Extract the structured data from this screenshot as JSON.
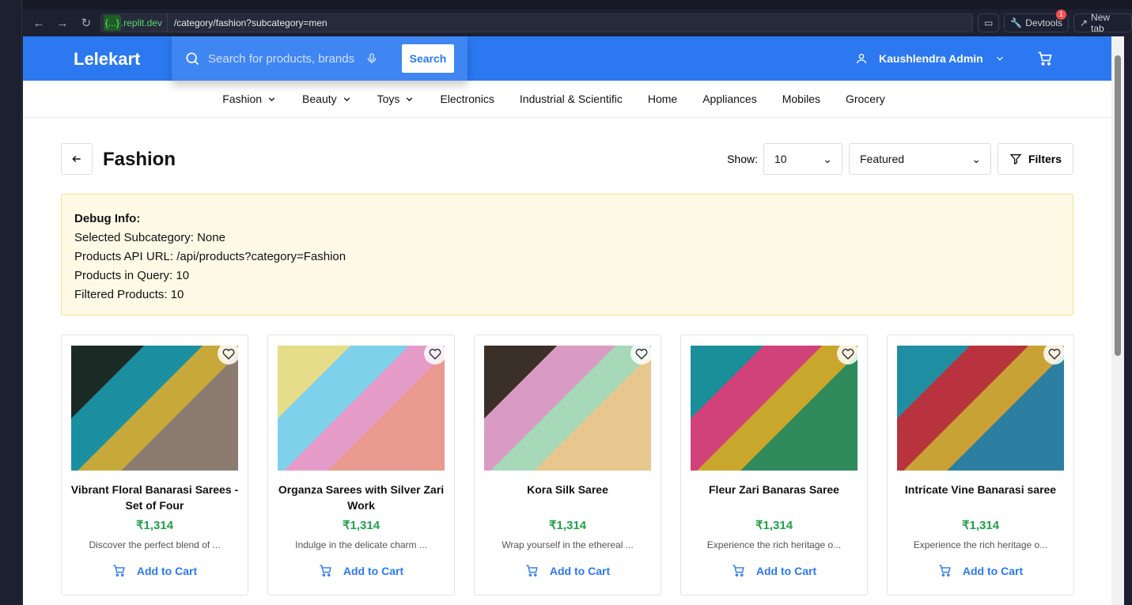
{
  "browser": {
    "domain_mask": "{...}",
    "domain": ".replit.dev",
    "path": "/category/fashion?subcategory=men",
    "devtools": "Devtools",
    "devtools_badge": "1",
    "new_tab": "New tab"
  },
  "header": {
    "logo": "Lelekart",
    "search_placeholder": "Search for products, brands and more",
    "search_button": "Search",
    "user": "Kaushlendra Admin"
  },
  "nav": [
    {
      "label": "Fashion",
      "dropdown": true
    },
    {
      "label": "Beauty",
      "dropdown": true
    },
    {
      "label": "Toys",
      "dropdown": true
    },
    {
      "label": "Electronics"
    },
    {
      "label": "Industrial & Scientific"
    },
    {
      "label": "Home"
    },
    {
      "label": "Appliances"
    },
    {
      "label": "Mobiles"
    },
    {
      "label": "Grocery"
    }
  ],
  "page": {
    "title": "Fashion",
    "show_label": "Show:",
    "show_value": "10",
    "sort_value": "Featured",
    "filters": "Filters"
  },
  "debug": {
    "title": "Debug Info:",
    "lines": [
      "Selected Subcategory: None",
      "Products API URL: /api/products?category=Fashion",
      "Products in Query: 10",
      "Filtered Products: 10"
    ]
  },
  "products": [
    {
      "name": "Vibrant Floral Banarasi Sarees - Set of Four",
      "price": "₹1,314",
      "desc": "Discover the perfect blend of ...",
      "cta": "Add to Cart",
      "colors": [
        "#1c2a26",
        "#1b8fa0",
        "#c7a93a",
        "#8a7d70"
      ]
    },
    {
      "name": "Organza Sarees with Silver Zari Work",
      "price": "₹1,314",
      "desc": "Indulge in the delicate charm ...",
      "cta": "Add to Cart",
      "colors": [
        "#e6dd8a",
        "#7fd0ea",
        "#e59bc8",
        "#e89a8f"
      ]
    },
    {
      "name": "Kora Silk Saree",
      "price": "₹1,314",
      "desc": "Wrap yourself in the ethereal ...",
      "cta": "Add to Cart",
      "colors": [
        "#3a3028",
        "#d99bc4",
        "#a6d9b8",
        "#e8c78f"
      ]
    },
    {
      "name": "Fleur Zari Banaras Saree",
      "price": "₹1,314",
      "desc": "Experience the rich heritage o...",
      "cta": "Add to Cart",
      "colors": [
        "#1a8f9a",
        "#d1427a",
        "#c9a62c",
        "#2f8a5c"
      ]
    },
    {
      "name": "Intricate Vine Banarasi saree",
      "price": "₹1,314",
      "desc": "Experience the rich heritage o...",
      "cta": "Add to Cart",
      "colors": [
        "#1f8ea3",
        "#b8333e",
        "#c9a236",
        "#2c7fa0"
      ]
    }
  ]
}
